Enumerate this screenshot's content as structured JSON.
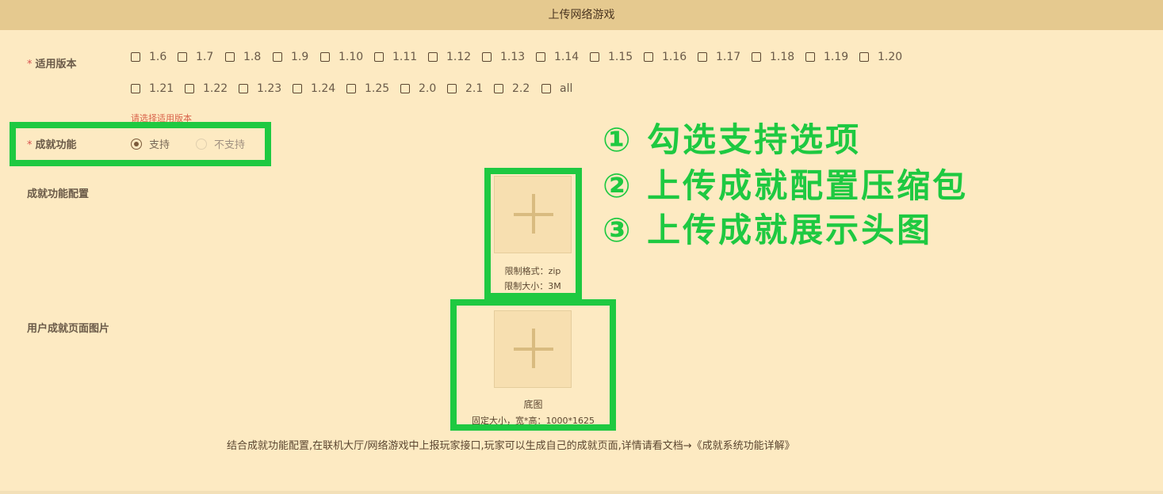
{
  "header": {
    "title": "上传网络游戏"
  },
  "version": {
    "required_mark": "*",
    "label": "适用版本",
    "options_row1": [
      "1.6",
      "1.7",
      "1.8",
      "1.9",
      "1.10",
      "1.11",
      "1.12",
      "1.13",
      "1.14",
      "1.15",
      "1.16",
      "1.17",
      "1.18",
      "1.19",
      "1.20"
    ],
    "options_row2": [
      "1.21",
      "1.22",
      "1.23",
      "1.24",
      "1.25",
      "2.0",
      "2.1",
      "2.2",
      "all"
    ],
    "error_hint": "请选择适用版本"
  },
  "achievement": {
    "required_mark": "*",
    "label": "成就功能",
    "options": [
      {
        "label": "支持",
        "selected": true
      },
      {
        "label": "不支持",
        "selected": false
      }
    ]
  },
  "config": {
    "label": "成就功能配置",
    "format_text": "限制格式：zip",
    "size_text": "限制大小：3M"
  },
  "page_image": {
    "label": "用户成就页面图片",
    "caption": "底图",
    "size_text": "固定大小，宽*高：1000*1625"
  },
  "description": "结合成就功能配置,在联机大厅/网络游戏中上报玩家接口,玩家可以生成自己的成就页面,详情请看文档→《成就系统功能详解》",
  "annotations": [
    "① 勾选支持选项",
    "② 上传成就配置压缩包",
    "③ 上传成就展示头图"
  ],
  "colors": {
    "highlight": "#1ec941",
    "background": "#fdeac2",
    "header": "#e5c98f"
  }
}
